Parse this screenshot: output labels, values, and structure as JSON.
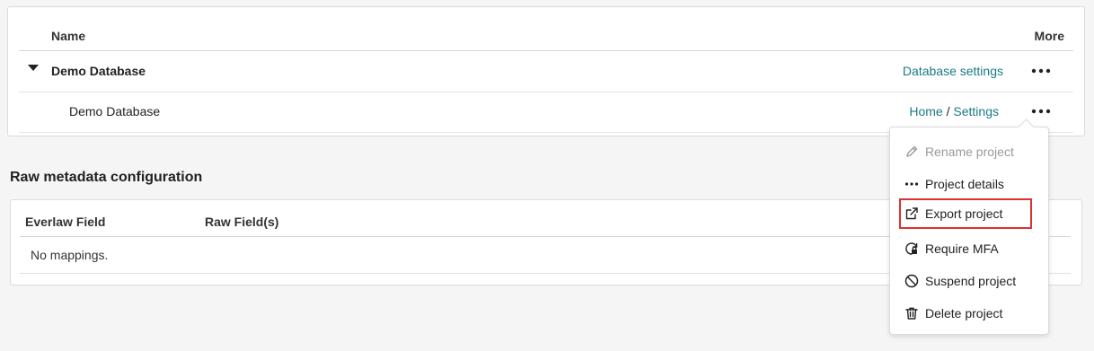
{
  "projects_table": {
    "columns": {
      "name": "Name",
      "more": "More"
    },
    "database": {
      "name": "Demo Database",
      "settings_link": "Database settings"
    },
    "project": {
      "name": "Demo Database",
      "home_link": "Home",
      "separator": "/",
      "settings_link": "Settings"
    }
  },
  "raw_metadata": {
    "title": "Raw metadata configuration",
    "columns": {
      "everlaw_field": "Everlaw Field",
      "raw_fields": "Raw Field(s)"
    },
    "empty_text": "No mappings."
  },
  "menu": {
    "items": [
      {
        "label": "Rename project",
        "icon": "pencil-icon",
        "disabled": true
      },
      {
        "label": "Project details",
        "icon": "ellipsis-icon"
      },
      {
        "label": "Export project",
        "icon": "external-link-icon",
        "highlighted": true
      },
      {
        "label": "Require MFA",
        "icon": "lock-refresh-icon"
      },
      {
        "label": "Suspend project",
        "icon": "ban-icon"
      },
      {
        "label": "Delete project",
        "icon": "trash-icon"
      }
    ]
  },
  "colors": {
    "link": "#1a7a85",
    "highlight_border": "#d9332f"
  }
}
